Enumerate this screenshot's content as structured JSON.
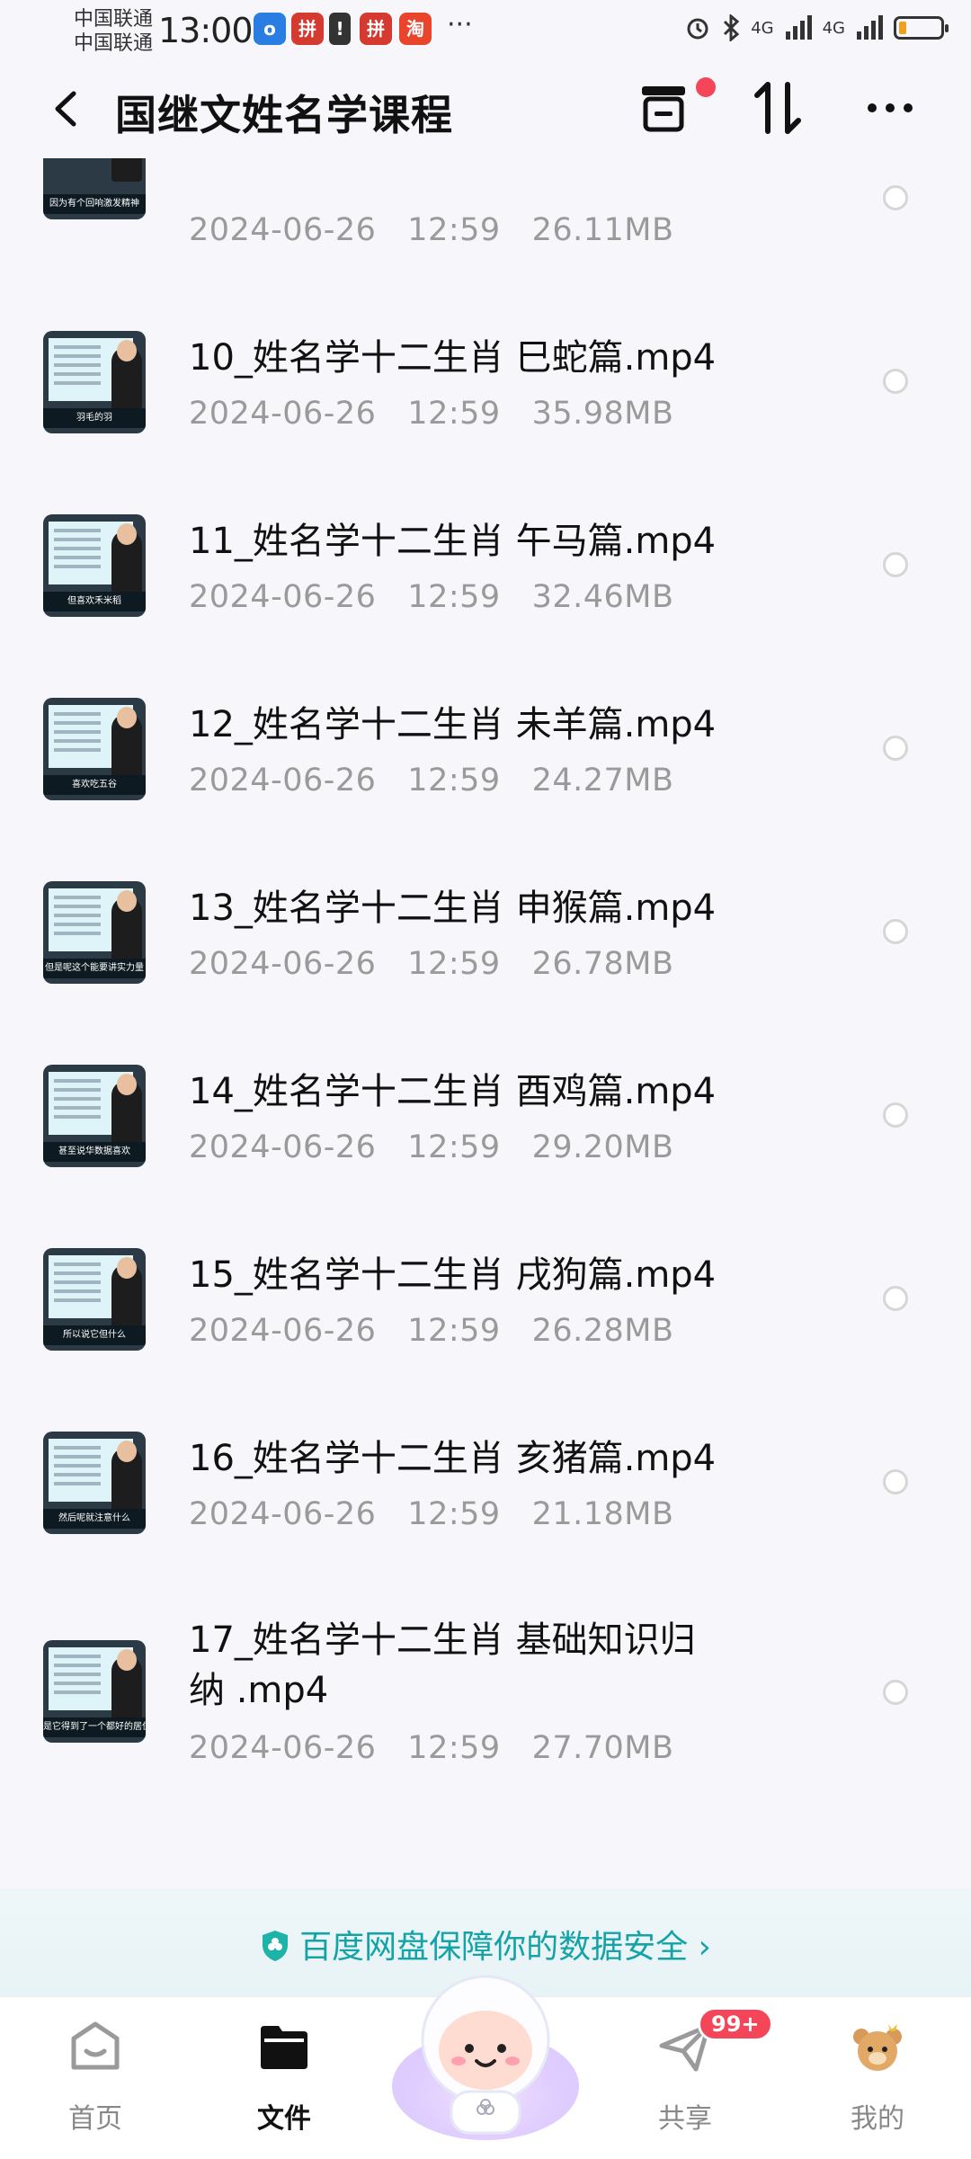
{
  "status_bar": {
    "carrier_1": "中国联通",
    "carrier_2": "中国联通",
    "time": "13:00",
    "more": "···",
    "signal_1": "4G",
    "signal_2": "4G"
  },
  "header": {
    "title": "国继文姓名学课程"
  },
  "files": [
    {
      "name": "",
      "date": "2024-06-26",
      "time": "12:59",
      "size": "26.11MB",
      "caption": "因为有个回响激发精神"
    },
    {
      "name": "10_姓名学十二生肖 巳蛇篇.mp4",
      "date": "2024-06-26",
      "time": "12:59",
      "size": "35.98MB",
      "caption": "羽毛的羽"
    },
    {
      "name": "11_姓名学十二生肖 午马篇.mp4",
      "date": "2024-06-26",
      "time": "12:59",
      "size": "32.46MB",
      "caption": "但喜欢禾米稻"
    },
    {
      "name": "12_姓名学十二生肖 未羊篇.mp4",
      "date": "2024-06-26",
      "time": "12:59",
      "size": "24.27MB",
      "caption": "喜欢吃五谷"
    },
    {
      "name": "13_姓名学十二生肖 申猴篇.mp4",
      "date": "2024-06-26",
      "time": "12:59",
      "size": "26.78MB",
      "caption": "但是呢这个能要讲实力量"
    },
    {
      "name": "14_姓名学十二生肖 酉鸡篇.mp4",
      "date": "2024-06-26",
      "time": "12:59",
      "size": "29.20MB",
      "caption": "甚至说华数据喜欢"
    },
    {
      "name": "15_姓名学十二生肖 戌狗篇.mp4",
      "date": "2024-06-26",
      "time": "12:59",
      "size": "26.28MB",
      "caption": "所以说它但什么"
    },
    {
      "name": "16_姓名学十二生肖 亥猪篇.mp4",
      "date": "2024-06-26",
      "time": "12:59",
      "size": "21.18MB",
      "caption": "然后呢就注意什么"
    },
    {
      "name_line1": "17_姓名学十二生肖 基础知识归",
      "name_line2": "纳 .mp4",
      "date": "2024-06-26",
      "time": "12:59",
      "size": "27.70MB",
      "caption": "是它得到了一个都好的居住环"
    }
  ],
  "banner": {
    "text": "百度网盘保障你的数据安全 ›"
  },
  "bottom_nav": {
    "tabs": [
      "首页",
      "文件",
      "共享",
      "我的"
    ],
    "active": "文件",
    "share_badge": "99+"
  },
  "colors": {
    "accent_teal": "#14a3a6",
    "badge_red": "#f44658",
    "background": "#f7f7fb"
  }
}
